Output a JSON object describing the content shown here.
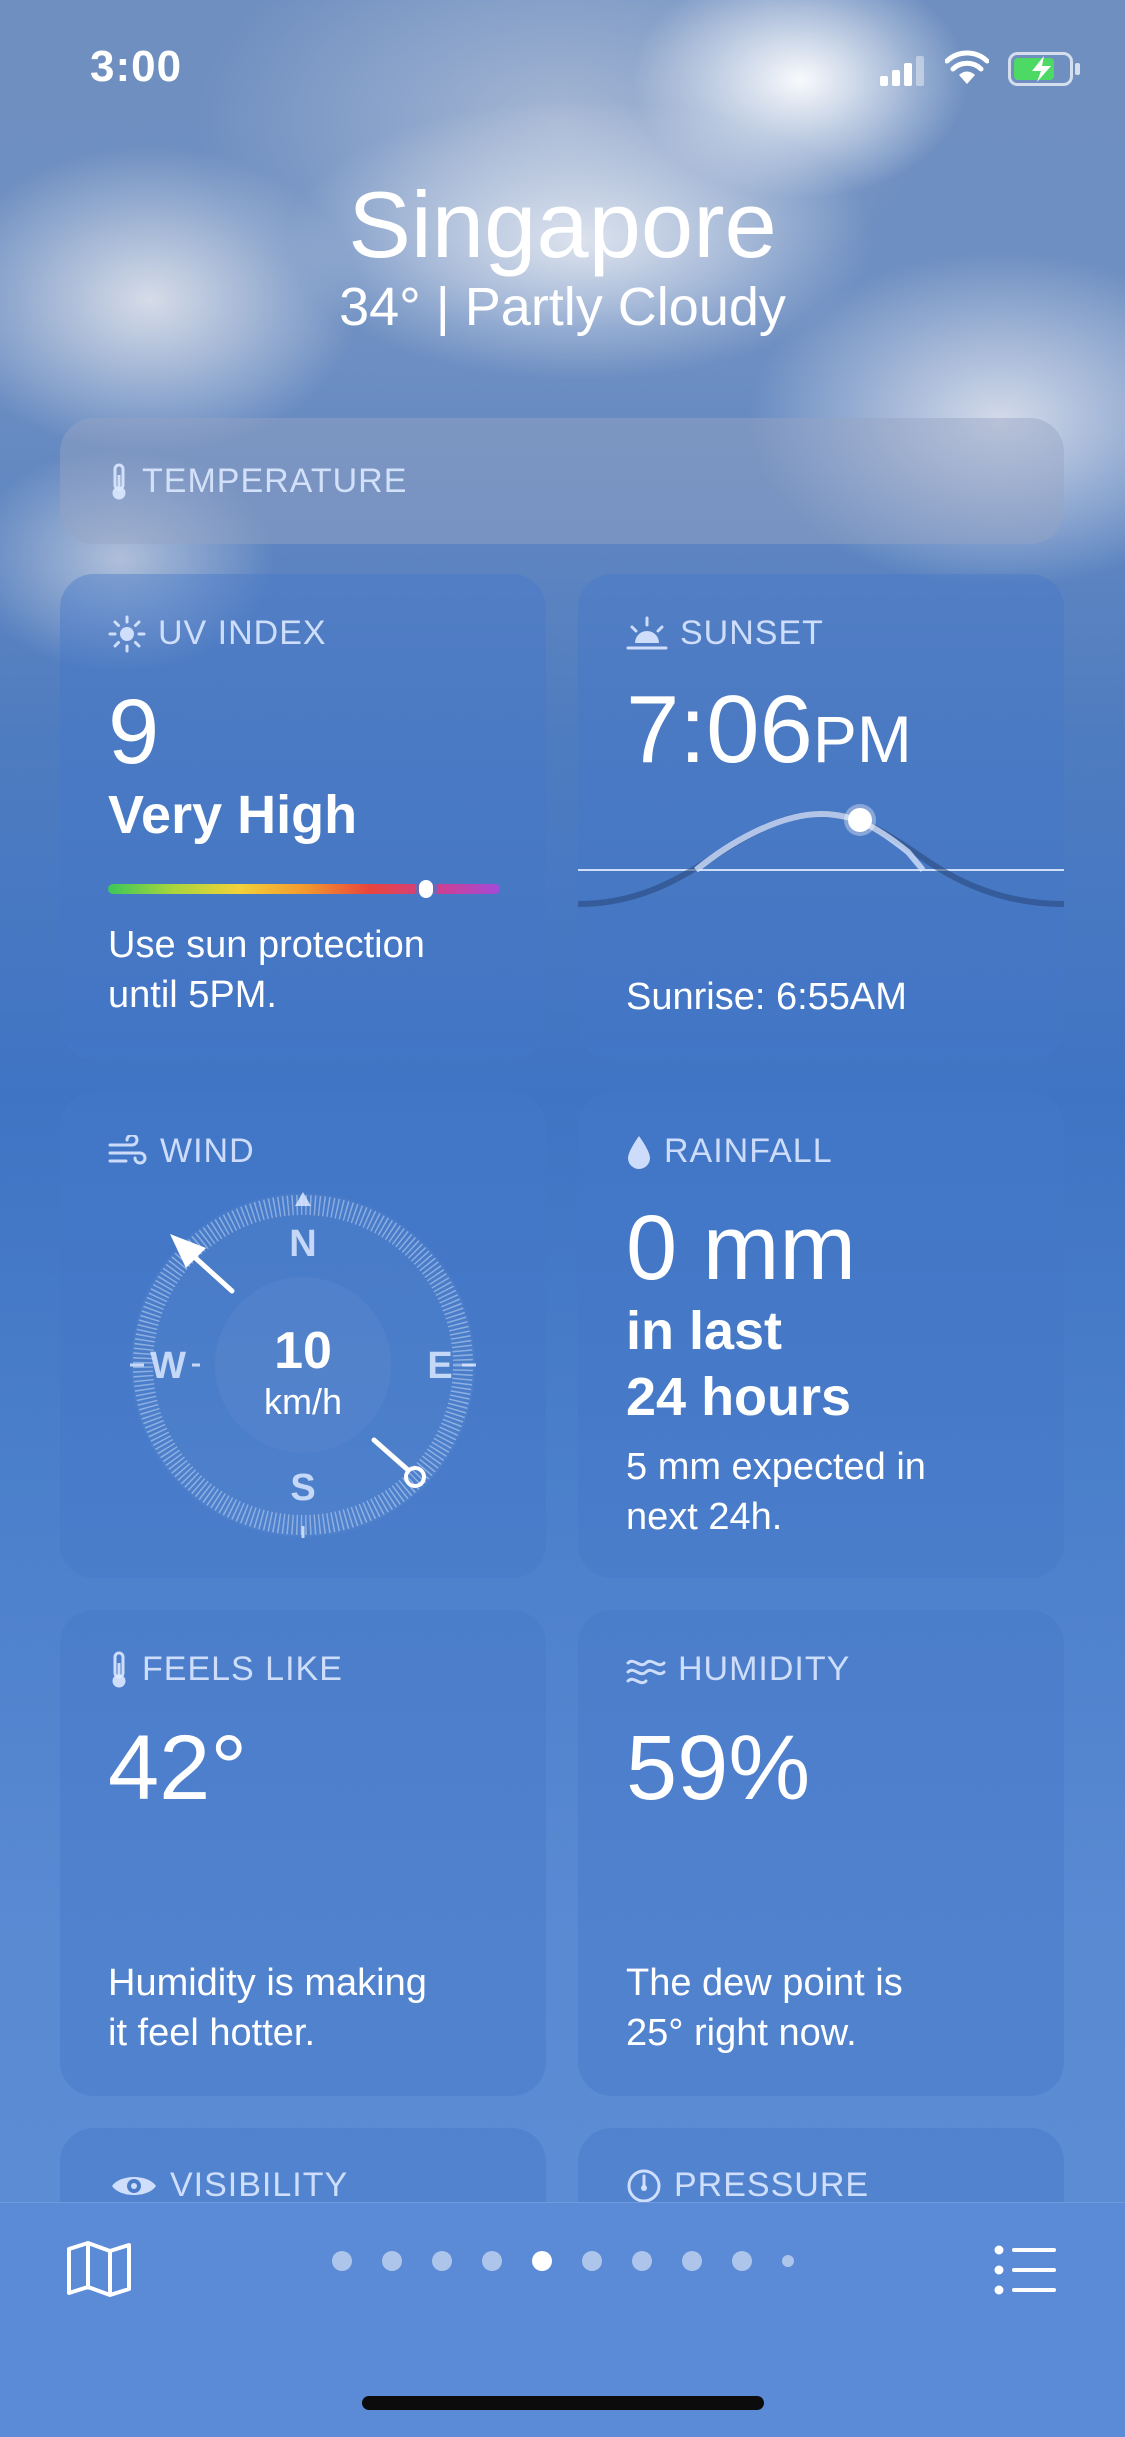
{
  "status_bar": {
    "time": "3:00"
  },
  "header": {
    "city": "Singapore",
    "summary": "34°  |  Partly Cloudy"
  },
  "cards": {
    "temperature": {
      "title": "TEMPERATURE"
    },
    "uv": {
      "title": "UV INDEX",
      "value": "9",
      "level": "Very High",
      "desc_line1": "Use sun protection",
      "desc_line2": "until 5PM.",
      "index_fraction": 0.81
    },
    "sunset": {
      "title": "SUNSET",
      "value": "7:06",
      "ampm": "PM",
      "sunrise": "Sunrise: 6:55AM"
    },
    "wind": {
      "title": "WIND",
      "speed": "10",
      "unit": "km/h",
      "north": "N",
      "south": "S",
      "east": "E",
      "west": "W"
    },
    "rainfall": {
      "title": "RAINFALL",
      "value": "0 mm",
      "line1": "in last",
      "line2": "24 hours",
      "desc_line1": "5 mm expected in",
      "desc_line2": "next 24h."
    },
    "feels_like": {
      "title": "FEELS LIKE",
      "value": "42°",
      "desc_line1": "Humidity is making",
      "desc_line2": "it feel hotter."
    },
    "humidity": {
      "title": "HUMIDITY",
      "value": "59%",
      "desc_line1": "The dew point is",
      "desc_line2": "25° right now."
    },
    "visibility": {
      "title": "VISIBILITY"
    },
    "pressure": {
      "title": "PRESSURE"
    }
  },
  "bottom_bar": {
    "map_icon": "map-icon",
    "list_icon": "list-icon",
    "page_count": 10,
    "active_page_index": 4
  },
  "colors": {
    "card_blue": "#4678c8",
    "bottom_bar": "#5b8ad6",
    "accent_white": "#ffffff"
  }
}
